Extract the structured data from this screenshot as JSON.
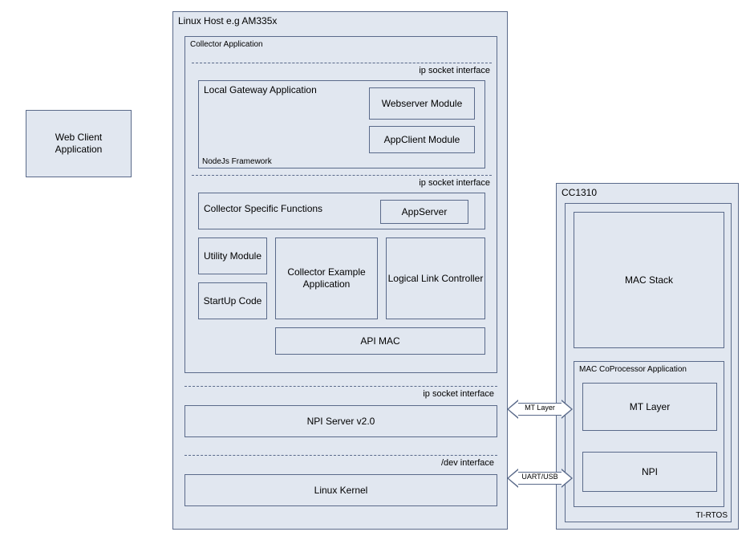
{
  "webclient": {
    "label": "Web Client\nApplication"
  },
  "host": {
    "title": "Linux Host e.g AM335x",
    "collector": {
      "title": "Collector Application",
      "iface1": "ip socket interface",
      "gateway": {
        "title": "Local Gateway Application",
        "footer": "NodeJs Framework",
        "webserver": "Webserver Module",
        "appclient": "AppClient Module"
      },
      "iface2": "ip socket interface",
      "csf": {
        "title": "Collector Specific Functions",
        "appserver": "AppServer"
      },
      "utility": "Utility Module",
      "startup": "StartUp Code",
      "collectorExample": "Collector Example Application",
      "llc": "Logical Link Controller",
      "apimac": "API MAC"
    },
    "iface3": "ip socket interface",
    "npi": "NPI Server v2.0",
    "iface4": "/dev interface",
    "kernel": "Linux Kernel"
  },
  "arrows": {
    "mt": "MT Layer",
    "uart": "UART/USB"
  },
  "cc1310": {
    "title": "CC1310",
    "rtos": "TI-RTOS",
    "mac": "MAC Stack",
    "cop": {
      "title": "MAC CoProcessor Application",
      "mt": "MT Layer",
      "npi": "NPI"
    }
  },
  "chart_data": {
    "type": "diagram",
    "title": "Linux Host / CC1310 architecture block diagram",
    "nodes": [
      {
        "id": "webclient",
        "label": "Web Client Application"
      },
      {
        "id": "linux_host",
        "label": "Linux Host e.g AM335x",
        "children": [
          {
            "id": "collector_app",
            "label": "Collector Application",
            "children": [
              {
                "id": "local_gateway",
                "label": "Local Gateway Application",
                "framework": "NodeJs Framework",
                "children": [
                  {
                    "id": "webserver",
                    "label": "Webserver Module"
                  },
                  {
                    "id": "appclient",
                    "label": "AppClient Module"
                  }
                ]
              },
              {
                "id": "csf",
                "label": "Collector Specific Functions",
                "children": [
                  {
                    "id": "appserver",
                    "label": "AppServer"
                  }
                ]
              },
              {
                "id": "utility",
                "label": "Utility Module"
              },
              {
                "id": "startup",
                "label": "StartUp Code"
              },
              {
                "id": "collector_example",
                "label": "Collector Example Application"
              },
              {
                "id": "llc",
                "label": "Logical Link Controller"
              },
              {
                "id": "apimac",
                "label": "API MAC"
              }
            ]
          },
          {
            "id": "npi_server",
            "label": "NPI Server v2.0"
          },
          {
            "id": "linux_kernel",
            "label": "Linux Kernel"
          }
        ]
      },
      {
        "id": "cc1310",
        "label": "CC1310",
        "children": [
          {
            "id": "tirtos",
            "label": "TI-RTOS",
            "children": [
              {
                "id": "mac_stack",
                "label": "MAC Stack"
              },
              {
                "id": "mac_cop",
                "label": "MAC CoProcessor Application",
                "children": [
                  {
                    "id": "mt_layer",
                    "label": "MT Layer"
                  },
                  {
                    "id": "npi",
                    "label": "NPI"
                  }
                ]
              }
            ]
          }
        ]
      }
    ],
    "interfaces": [
      {
        "between": [
          "collector_app_top",
          "local_gateway"
        ],
        "label": "ip socket interface"
      },
      {
        "between": [
          "local_gateway",
          "csf"
        ],
        "label": "ip socket interface"
      },
      {
        "between": [
          "collector_app",
          "npi_server"
        ],
        "label": "ip socket interface"
      },
      {
        "between": [
          "npi_server",
          "linux_kernel"
        ],
        "label": "/dev interface"
      }
    ],
    "links": [
      {
        "from": "npi_server",
        "to": "mt_layer",
        "label": "MT Layer",
        "bidirectional": true
      },
      {
        "from": "linux_kernel",
        "to": "npi",
        "label": "UART/USB",
        "bidirectional": true
      }
    ]
  }
}
